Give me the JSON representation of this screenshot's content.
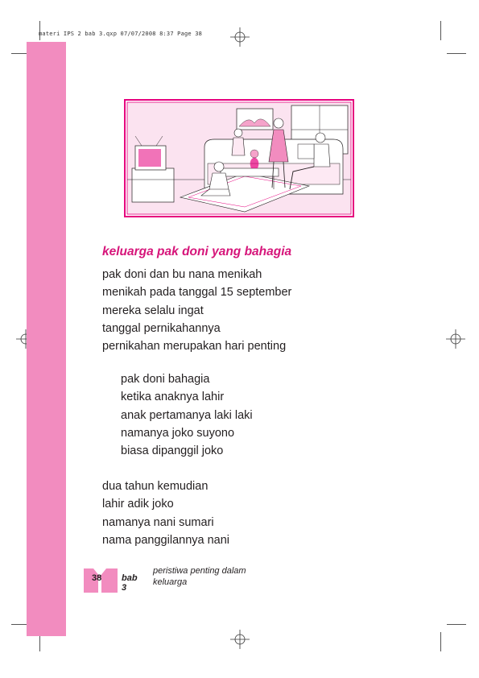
{
  "slug_line": "materi IPS 2 bab 3.qxp  07/07/2008  8:37  Page 38",
  "illustration": {
    "icon": "family-living-room-illustration",
    "accent_color": "#e6007e",
    "line_color": "#231f20"
  },
  "title": "keluarga pak doni yang bahagia",
  "stanzas": [
    [
      "pak doni dan bu nana menikah",
      "menikah pada tanggal 15 september",
      "mereka selalu ingat",
      "tanggal pernikahannya",
      "pernikahan merupakan hari penting"
    ],
    [
      "pak doni bahagia",
      "ketika anaknya lahir",
      "anak pertamanya laki laki",
      "namanya joko suyono",
      "biasa dipanggil joko"
    ],
    [
      "dua tahun kemudian",
      "lahir adik joko",
      "namanya nani sumari",
      "nama panggilannya nani"
    ]
  ],
  "footer": {
    "page_number": "38",
    "chapter": "bab 3",
    "chapter_title": "peristiwa penting dalam keluarga"
  },
  "colors": {
    "pink_bar": "#f28cbf",
    "title": "#d6157a",
    "text": "#231f20"
  }
}
